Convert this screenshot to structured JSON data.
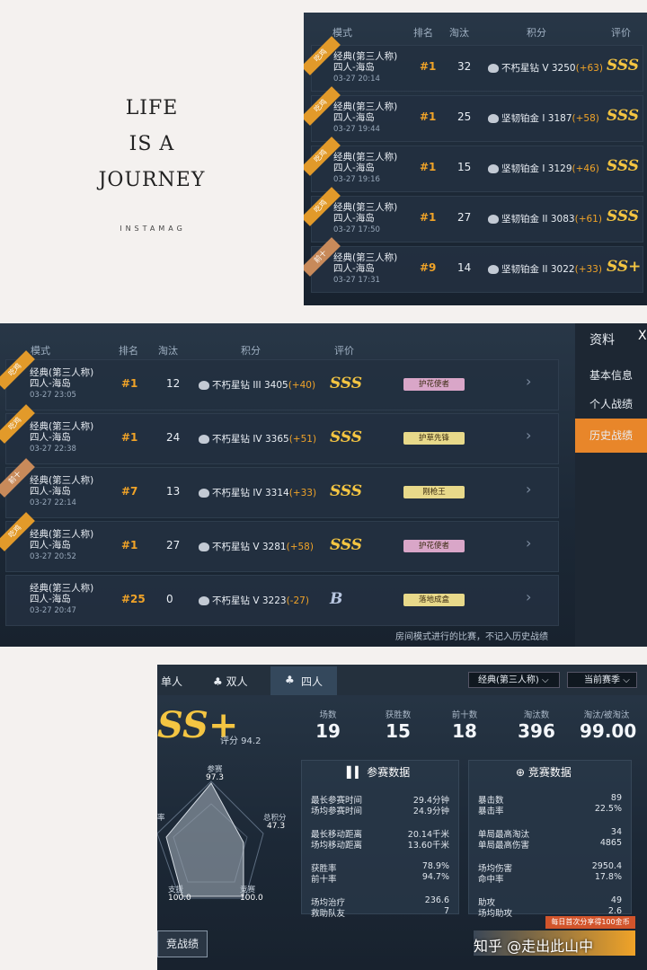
{
  "life_card": {
    "line1": "LIFE",
    "line2": "IS A",
    "line3": "JOURNEY",
    "brand": "INSTAMAG"
  },
  "panel1": {
    "headers": {
      "mode": "模式",
      "rank": "排名",
      "kills": "淘汰",
      "score": "积分",
      "rating": "评价"
    },
    "rows": [
      {
        "ribbon": "吃鸡",
        "mode1": "经典(第三人称)",
        "mode2": "四人-海岛",
        "date": "03-27 20:14",
        "rank": "#1",
        "kills": "32",
        "score": "不朽星钻 V 3250",
        "delta": "(+63)",
        "grade": "SSS"
      },
      {
        "ribbon": "吃鸡",
        "mode1": "经典(第三人称)",
        "mode2": "四人-海岛",
        "date": "03-27 19:44",
        "rank": "#1",
        "kills": "25",
        "score": "坚韧铂金 I 3187",
        "delta": "(+58)",
        "grade": "SSS"
      },
      {
        "ribbon": "吃鸡",
        "mode1": "经典(第三人称)",
        "mode2": "四人-海岛",
        "date": "03-27 19:16",
        "rank": "#1",
        "kills": "15",
        "score": "坚韧铂金 I 3129",
        "delta": "(+46)",
        "grade": "SSS"
      },
      {
        "ribbon": "吃鸡",
        "mode1": "经典(第三人称)",
        "mode2": "四人-海岛",
        "date": "03-27 17:50",
        "rank": "#1",
        "kills": "27",
        "score": "坚韧铂金 II 3083",
        "delta": "(+61)",
        "grade": "SSS"
      },
      {
        "ribbon": "前十",
        "mode1": "经典(第三人称)",
        "mode2": "四人-海岛",
        "date": "03-27 17:31",
        "rank": "#9",
        "kills": "14",
        "score": "坚韧铂金 II 3022",
        "delta": "(+33)",
        "grade": "SS+"
      }
    ]
  },
  "panel2": {
    "headers": {
      "mode": "模式",
      "rank": "排名",
      "kills": "淘汰",
      "score": "积分",
      "rating": "评价"
    },
    "side": {
      "title": "资料",
      "close": "X",
      "items": [
        "基本信息",
        "个人战绩",
        "历史战绩"
      ]
    },
    "rows": [
      {
        "ribbon": "吃鸡",
        "mode1": "经典(第三人称)",
        "mode2": "四人-海岛",
        "date": "03-27 23:05",
        "rank": "#1",
        "kills": "12",
        "score": "不朽星钻 III 3405",
        "delta": "(+40)",
        "grade": "SSS",
        "badge": "护花使者"
      },
      {
        "ribbon": "吃鸡",
        "mode1": "经典(第三人称)",
        "mode2": "四人-海岛",
        "date": "03-27 22:38",
        "rank": "#1",
        "kills": "24",
        "score": "不朽星钻 IV 3365",
        "delta": "(+51)",
        "grade": "SSS",
        "badge": "护草先锋"
      },
      {
        "ribbon": "前十",
        "mode1": "经典(第三人称)",
        "mode2": "四人-海岛",
        "date": "03-27 22:14",
        "rank": "#7",
        "kills": "13",
        "score": "不朽星钻 IV 3314",
        "delta": "(+33)",
        "grade": "SSS",
        "badge": "刚枪王"
      },
      {
        "ribbon": "吃鸡",
        "mode1": "经典(第三人称)",
        "mode2": "四人-海岛",
        "date": "03-27 20:52",
        "rank": "#1",
        "kills": "27",
        "score": "不朽星钻 V 3281",
        "delta": "(+58)",
        "grade": "SSS",
        "badge": "护花使者"
      },
      {
        "ribbon": "",
        "mode1": "经典(第三人称)",
        "mode2": "四人-海岛",
        "date": "03-27 20:47",
        "rank": "#25",
        "kills": "0",
        "score": "不朽星钻 V 3223",
        "delta": "(-27)",
        "grade": "B",
        "badge": "落地成盒"
      }
    ],
    "footer_note": "房间模式进行的比赛，不记入历史战绩"
  },
  "panel3": {
    "tabs": [
      "单人",
      "双人",
      "四人"
    ],
    "mode_select": "经典(第三人称)",
    "season_select": "当前赛季",
    "grade": "SS+",
    "score_label": "评分 94.2",
    "stats": [
      {
        "label": "场数",
        "value": "19"
      },
      {
        "label": "获胜数",
        "value": "15"
      },
      {
        "label": "前十数",
        "value": "18"
      },
      {
        "label": "淘汰数",
        "value": "396"
      },
      {
        "label": "淘汰/被淘汰",
        "value": "99.00"
      }
    ],
    "radar": {
      "participation_label": "参赛",
      "participation": "97.3",
      "total_label": "总积分",
      "total": "47.3",
      "survival_label": "支援",
      "survival": "100.0",
      "match_label": "竞赛",
      "match": "100.0",
      "left_label": "率"
    },
    "box1": {
      "title": "参赛数据",
      "rows": [
        [
          "最长参赛时间",
          "29.4分钟"
        ],
        [
          "场均参赛时间",
          "24.9分钟"
        ],
        [
          "最长移动距离",
          "20.14千米"
        ],
        [
          "场均移动距离",
          "13.60千米"
        ],
        [
          "获胜率",
          "78.9%"
        ],
        [
          "前十率",
          "94.7%"
        ],
        [
          "场均治疗",
          "236.6"
        ],
        [
          "救助队友",
          "7"
        ]
      ]
    },
    "box2": {
      "title": "竞赛数据",
      "rows": [
        [
          "暴击数",
          "89"
        ],
        [
          "暴击率",
          "22.5%"
        ],
        [
          "单局最高淘汰",
          "34"
        ],
        [
          "单局最高伤害",
          "4865"
        ],
        [
          "场均伤害",
          "2950.4"
        ],
        [
          "命中率",
          "17.8%"
        ],
        [
          "助攻",
          "49"
        ],
        [
          "场均助攻",
          "2.6"
        ]
      ]
    },
    "bottom_left": "竞战绩",
    "bottom_banner": "每日首次分享得100金币",
    "watermark": "知乎 @走出此山中"
  },
  "colors": {
    "accent": "#f0a328",
    "grade": "#f4c542",
    "panel": "#1c2836"
  }
}
